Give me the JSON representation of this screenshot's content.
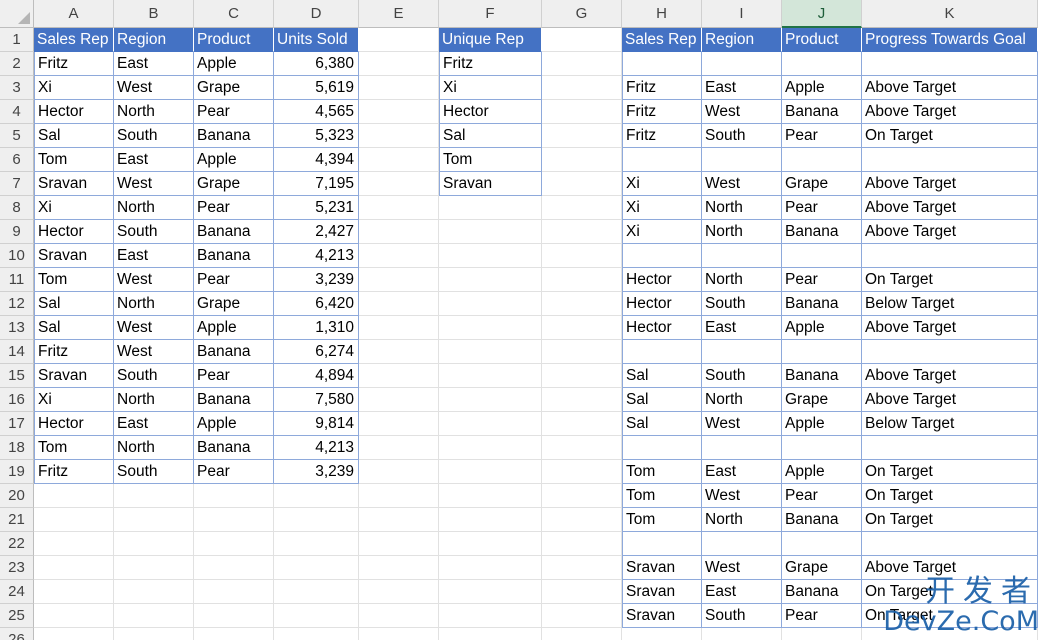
{
  "column_letters": [
    "A",
    "B",
    "C",
    "D",
    "E",
    "F",
    "G",
    "H",
    "I",
    "J",
    "K"
  ],
  "selected_column": "J",
  "row_numbers": [
    "1",
    "2",
    "3",
    "4",
    "5",
    "6",
    "7",
    "8",
    "9",
    "10",
    "11",
    "12",
    "13",
    "14",
    "15",
    "16",
    "17",
    "18",
    "19",
    "20",
    "21",
    "22",
    "23",
    "24",
    "25",
    "26"
  ],
  "header_fill": "#4472C4",
  "sales_table": {
    "headers": [
      "Sales Rep",
      "Region",
      "Product",
      "Units Sold"
    ],
    "rows": [
      [
        "Fritz",
        "East",
        "Apple",
        "6,380"
      ],
      [
        "Xi",
        "West",
        "Grape",
        "5,619"
      ],
      [
        "Hector",
        "North",
        "Pear",
        "4,565"
      ],
      [
        "Sal",
        "South",
        "Banana",
        "5,323"
      ],
      [
        "Tom",
        "East",
        "Apple",
        "4,394"
      ],
      [
        "Sravan",
        "West",
        "Grape",
        "7,195"
      ],
      [
        "Xi",
        "North",
        "Pear",
        "5,231"
      ],
      [
        "Hector",
        "South",
        "Banana",
        "2,427"
      ],
      [
        "Sravan",
        "East",
        "Banana",
        "4,213"
      ],
      [
        "Tom",
        "West",
        "Pear",
        "3,239"
      ],
      [
        "Sal",
        "North",
        "Grape",
        "6,420"
      ],
      [
        "Sal",
        "West",
        "Apple",
        "1,310"
      ],
      [
        "Fritz",
        "West",
        "Banana",
        "6,274"
      ],
      [
        "Sravan",
        "South",
        "Pear",
        "4,894"
      ],
      [
        "Xi",
        "North",
        "Banana",
        "7,580"
      ],
      [
        "Hector",
        "East",
        "Apple",
        "9,814"
      ],
      [
        "Tom",
        "North",
        "Banana",
        "4,213"
      ],
      [
        "Fritz",
        "South",
        "Pear",
        "3,239"
      ]
    ]
  },
  "unique_table": {
    "header": "Unique Rep",
    "values": [
      "Fritz",
      "Xi",
      "Hector",
      "Sal",
      "Tom",
      "Sravan"
    ]
  },
  "progress_table": {
    "headers": [
      "Sales Rep",
      "Region",
      "Product",
      "Progress Towards Goal"
    ],
    "rows": [
      [
        "",
        "",
        "",
        ""
      ],
      [
        "Fritz",
        "East",
        "Apple",
        "Above Target"
      ],
      [
        "Fritz",
        "West",
        "Banana",
        "Above Target"
      ],
      [
        "Fritz",
        "South",
        "Pear",
        "On Target"
      ],
      [
        "",
        "",
        "",
        ""
      ],
      [
        "Xi",
        "West",
        "Grape",
        "Above Target"
      ],
      [
        "Xi",
        "North",
        "Pear",
        "Above Target"
      ],
      [
        "Xi",
        "North",
        "Banana",
        "Above Target"
      ],
      [
        "",
        "",
        "",
        ""
      ],
      [
        "Hector",
        "North",
        "Pear",
        "On Target"
      ],
      [
        "Hector",
        "South",
        "Banana",
        "Below Target"
      ],
      [
        "Hector",
        "East",
        "Apple",
        "Above Target"
      ],
      [
        "",
        "",
        "",
        ""
      ],
      [
        "Sal",
        "South",
        "Banana",
        "Above Target"
      ],
      [
        "Sal",
        "North",
        "Grape",
        "Above Target"
      ],
      [
        "Sal",
        "West",
        "Apple",
        "Below Target"
      ],
      [
        "",
        "",
        "",
        ""
      ],
      [
        "Tom",
        "East",
        "Apple",
        "On Target"
      ],
      [
        "Tom",
        "West",
        "Pear",
        "On Target"
      ],
      [
        "Tom",
        "North",
        "Banana",
        "On Target"
      ],
      [
        "",
        "",
        "",
        ""
      ],
      [
        "Sravan",
        "West",
        "Grape",
        "Above Target"
      ],
      [
        "Sravan",
        "East",
        "Banana",
        "On Target"
      ],
      [
        "Sravan",
        "South",
        "Pear",
        "On Target"
      ]
    ]
  },
  "watermark": {
    "chinese": "开发者",
    "latin": "DevZe.CoM"
  }
}
